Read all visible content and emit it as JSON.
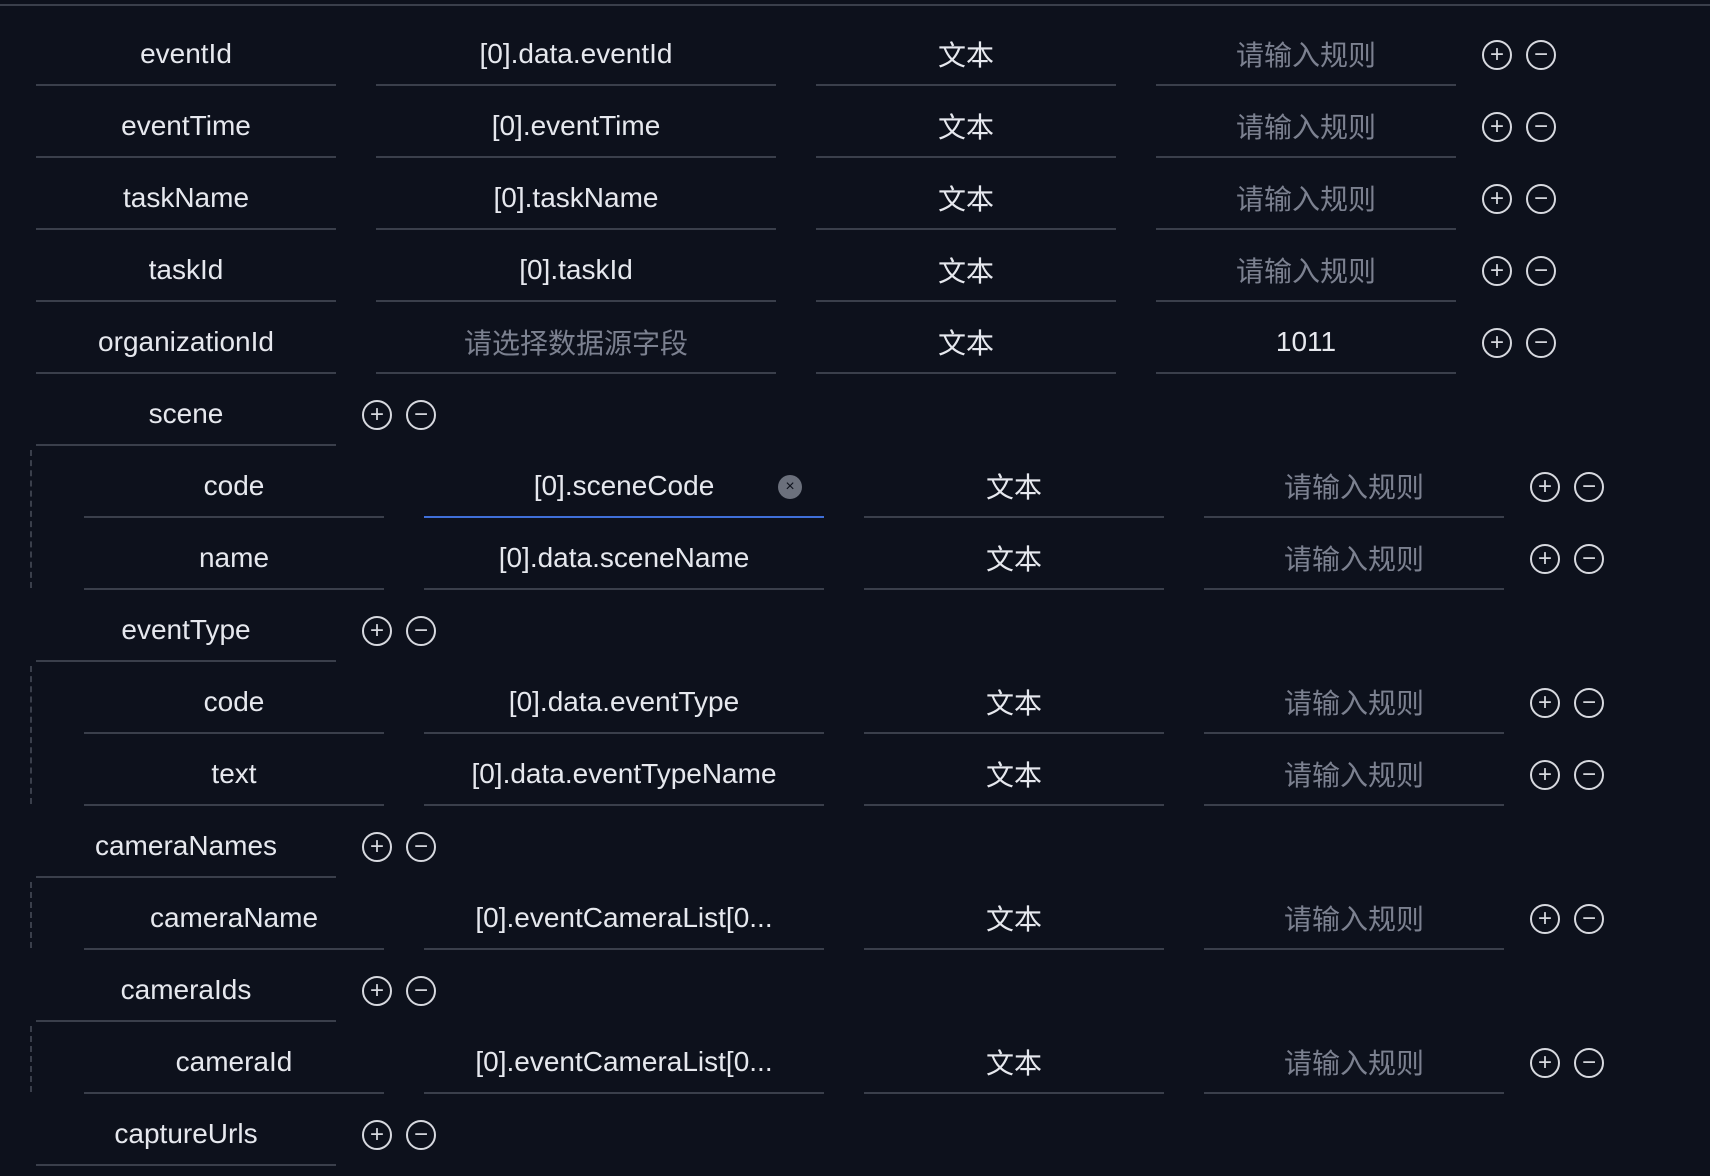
{
  "rows": [
    {
      "key": "eventId",
      "level": 0,
      "type": "leaf",
      "source": "[0].data.eventId",
      "dtype": "文本",
      "rule": "请输入规则",
      "rule_placeholder": true
    },
    {
      "key": "eventTime",
      "level": 0,
      "type": "leaf",
      "source": "[0].eventTime",
      "dtype": "文本",
      "rule": "请输入规则",
      "rule_placeholder": true
    },
    {
      "key": "taskName",
      "level": 0,
      "type": "leaf",
      "source": "[0].taskName",
      "dtype": "文本",
      "rule": "请输入规则",
      "rule_placeholder": true
    },
    {
      "key": "taskId",
      "level": 0,
      "type": "leaf",
      "source": "[0].taskId",
      "dtype": "文本",
      "rule": "请输入规则",
      "rule_placeholder": true
    },
    {
      "key": "organizationId",
      "level": 0,
      "type": "leaf",
      "source": "请选择数据源字段",
      "source_placeholder": true,
      "dtype": "文本",
      "rule": "1011",
      "rule_placeholder": false
    },
    {
      "key": "scene",
      "level": 0,
      "type": "group"
    },
    {
      "key": "code",
      "level": 1,
      "type": "leaf",
      "source": "[0].sceneCode",
      "focused": true,
      "dtype": "文本",
      "rule": "请输入规则",
      "rule_placeholder": true
    },
    {
      "key": "name",
      "level": 1,
      "type": "leaf",
      "source": "[0].data.sceneName",
      "dtype": "文本",
      "rule": "请输入规则",
      "rule_placeholder": true
    },
    {
      "key": "eventType",
      "level": 0,
      "type": "group"
    },
    {
      "key": "code",
      "level": 1,
      "type": "leaf",
      "source": "[0].data.eventType",
      "dtype": "文本",
      "rule": "请输入规则",
      "rule_placeholder": true
    },
    {
      "key": "text",
      "level": 1,
      "type": "leaf",
      "source": "[0].data.eventTypeName",
      "dtype": "文本",
      "rule": "请输入规则",
      "rule_placeholder": true
    },
    {
      "key": "cameraNames",
      "level": 0,
      "type": "group"
    },
    {
      "key": "cameraName",
      "level": 1,
      "type": "leaf",
      "source": "[0].eventCameraList[0...",
      "dtype": "文本",
      "rule": "请输入规则",
      "rule_placeholder": true
    },
    {
      "key": "cameraIds",
      "level": 0,
      "type": "group"
    },
    {
      "key": "cameraId",
      "level": 1,
      "type": "leaf",
      "source": "[0].eventCameraList[0...",
      "dtype": "文本",
      "rule": "请输入规则",
      "rule_placeholder": true
    },
    {
      "key": "captureUrls",
      "level": 0,
      "type": "group"
    }
  ],
  "icons": {
    "add": "plus-circle-icon",
    "remove": "minus-circle-icon",
    "clear": "clear-circle-icon"
  },
  "colors": {
    "background": "#0d111c",
    "underline": "#3a3f4b",
    "focus": "#3f6fd8",
    "placeholder": "#7c8190",
    "text": "#e6e8ee"
  }
}
